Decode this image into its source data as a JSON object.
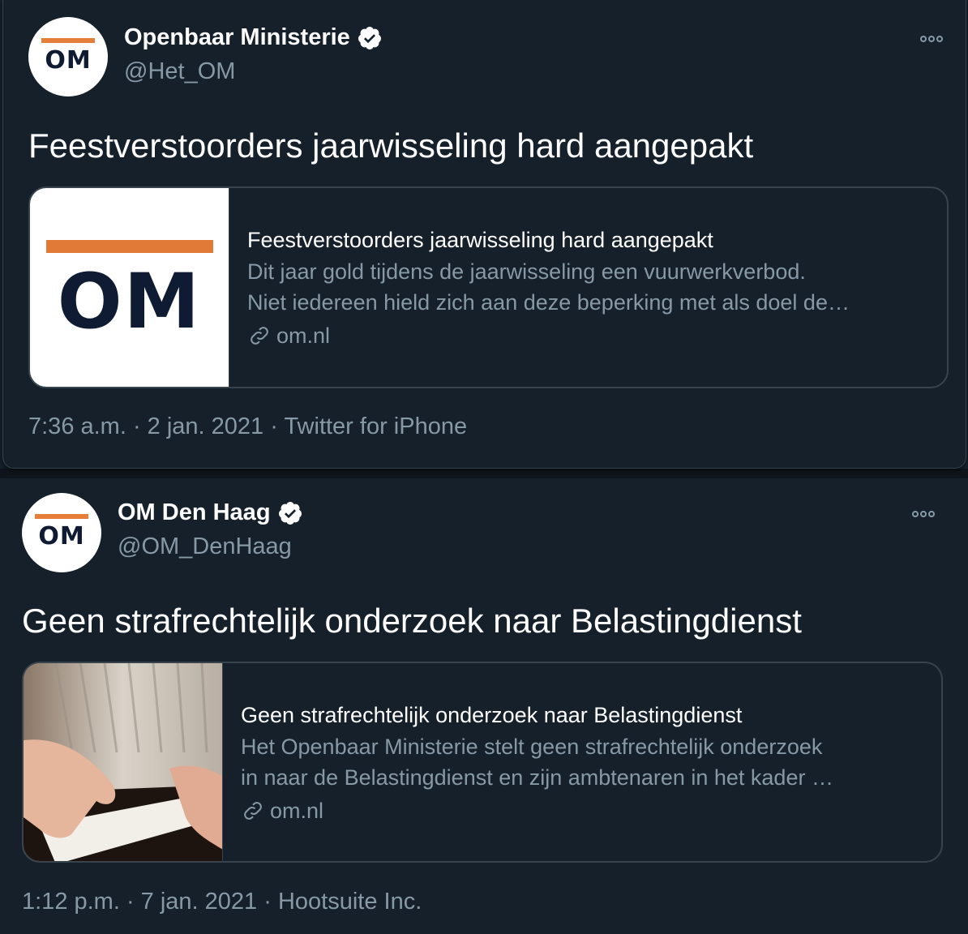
{
  "tweets": [
    {
      "author_name": "Openbaar Ministerie",
      "handle": "@Het_OM",
      "avatar_text": "OM",
      "text": "Feestverstoorders jaarwisseling hard aangepakt",
      "card": {
        "image_text": "OM",
        "title": "Feestverstoorders jaarwisseling hard aangepakt",
        "description_line1": "Dit jaar gold tijdens de jaarwisseling een vuurwerkverbod.",
        "description_line2": "Niet iedereen hield zich aan deze beperking met als doel de…",
        "domain": "om.nl"
      },
      "timestamp": "7:36 a.m. · 2 jan. 2021 · ",
      "source": "Twitter for iPhone"
    },
    {
      "author_name": "OM Den Haag",
      "handle": "@OM_DenHaag",
      "avatar_text": "OM",
      "text": "Geen strafrechtelijk onderzoek naar Belastingdienst",
      "card": {
        "title": "Geen strafrechtelijk onderzoek naar Belastingdienst",
        "description_line1": "Het Openbaar Ministerie stelt geen strafrechtelijk onderzoek",
        "description_line2": "in naar de Belastingdienst en zijn ambtenaren in het kader …",
        "domain": "om.nl"
      },
      "timestamp": "1:12 p.m. · 7 jan. 2021 · ",
      "source": "Hootsuite Inc."
    }
  ],
  "colors": {
    "background": "#15202b",
    "secondary_text": "#8899a6",
    "border": "#38444d",
    "brand_orange": "#e67e3a",
    "brand_navy": "#0f1b33"
  },
  "icons": [
    "verified-badge-icon",
    "more-options-icon",
    "link-icon"
  ]
}
